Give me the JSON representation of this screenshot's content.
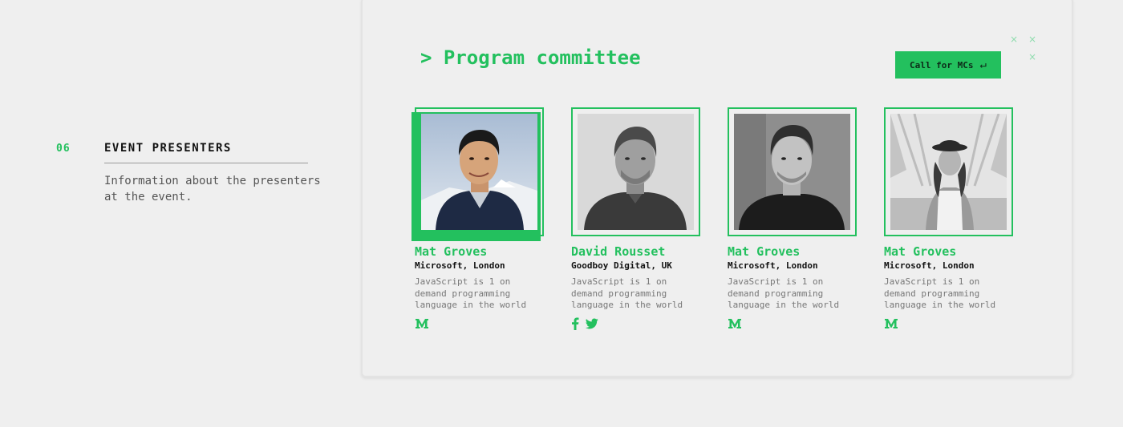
{
  "section": {
    "number": "06",
    "title": "EVENT PRESENTERS",
    "description": "Information about the presenters at the event."
  },
  "card": {
    "title": "> Program committee",
    "cta_label": "Call for MCs",
    "cta_icon": "enter-arrow-icon",
    "deco_glyph": "×"
  },
  "presenters": [
    {
      "name": "Mat Groves",
      "org": "Microsoft, London",
      "bio": "JavaScript is 1 on demand programming language in the world",
      "photo_style": "color",
      "socials": [
        "medium-icon"
      ]
    },
    {
      "name": "David Rousset",
      "org": "Goodboy Digital, UK",
      "bio": "JavaScript is 1 on demand programming language in the world",
      "photo_style": "grayscale",
      "socials": [
        "facebook-icon",
        "twitter-icon"
      ]
    },
    {
      "name": "Mat Groves",
      "org": "Microsoft, London",
      "bio": "JavaScript is 1 on demand programming language in the world",
      "photo_style": "grayscale",
      "socials": [
        "medium-icon"
      ]
    },
    {
      "name": "Mat Groves",
      "org": "Microsoft, London",
      "bio": "JavaScript is 1 on demand programming language in the world",
      "photo_style": "grayscale",
      "socials": [
        "medium-icon"
      ]
    }
  ],
  "colors": {
    "accent": "#23c05e",
    "background": "#efefef",
    "text": "#111111",
    "muted": "#777777"
  }
}
